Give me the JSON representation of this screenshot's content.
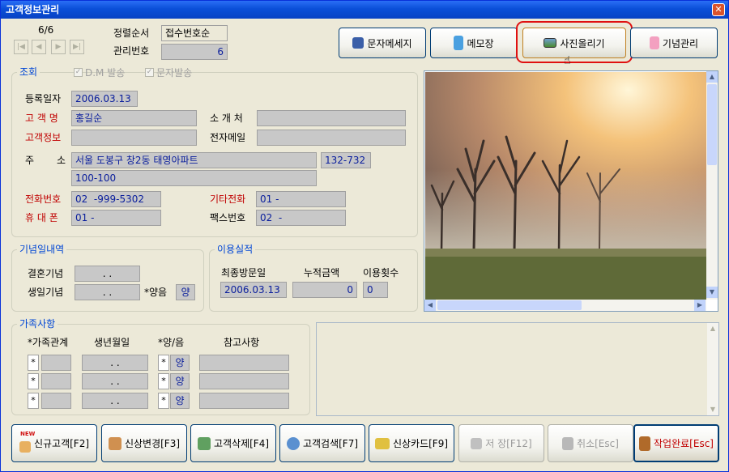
{
  "window": {
    "title": "고객정보관리"
  },
  "record": {
    "counter": "6/6",
    "sort_label": "정렬순서",
    "sort_value": "접수번호순",
    "mgmt_label": "관리번호",
    "mgmt_value": "6"
  },
  "toolbar": {
    "sms": "문자메세지",
    "memo": "메모장",
    "photo": "사진올리기",
    "anniv": "기념관리"
  },
  "inquiry": {
    "title": "조회",
    "dm": "D.M 발송",
    "sms": "문자발송",
    "reg_date_label": "등록일자",
    "reg_date": "2006.03.13",
    "name_label": "고 객 명",
    "name": "홍길순",
    "referrer_label": "소 개 처",
    "referrer": "",
    "info_label": "고객정보",
    "info": "",
    "email_label": "전자메일",
    "email": "",
    "addr_label1": "주",
    "addr_label2": "소",
    "addr1": "서울 도봉구 창2동 태영아파트",
    "zip": "132-732",
    "addr2": "100-100",
    "phone_label": "전화번호",
    "phone": "02  -999-5302",
    "other_phone_label": "기타전화",
    "other_phone": "01 -",
    "mobile_label": "휴 대 폰",
    "mobile": "01 -",
    "fax_label": "팩스번호",
    "fax": "02  -"
  },
  "anniversary": {
    "title": "기념일내역",
    "wedding_label": "결혼기념",
    "wedding": ". .",
    "birth_label": "생일기념",
    "birth": ". .",
    "lunar_label": "*양음",
    "lunar": "양"
  },
  "usage": {
    "title": "이용실적",
    "last_visit_label": "최종방문일",
    "total_label": "누적금액",
    "count_label": "이용횟수",
    "last_visit": "2006.03.13",
    "total": "0",
    "count": "0"
  },
  "family": {
    "title": "가족사항",
    "h_rel": "*가족관계",
    "h_birth": "생년월일",
    "h_lunar": "*양/음",
    "h_note": "참고사항",
    "rows": [
      {
        "star": "*",
        "rel": "",
        "birth": ". .",
        "star2": "*",
        "lunar": "양",
        "note": ""
      },
      {
        "star": "*",
        "rel": "",
        "birth": ". .",
        "star2": "*",
        "lunar": "양",
        "note": ""
      },
      {
        "star": "*",
        "rel": "",
        "birth": ". .",
        "star2": "*",
        "lunar": "양",
        "note": ""
      }
    ]
  },
  "bottom": {
    "new": "신규고객[F2]",
    "edit": "신상변경[F3]",
    "del": "고객삭제[F4]",
    "search": "고객검색[F7]",
    "card": "신상카드[F9]",
    "save": "저 장[F12]",
    "cancel": "취소[Esc]",
    "done": "작업완료[Esc]"
  },
  "new_badge": "NEW",
  "colors": {
    "title_bar": "#0a4fd8",
    "highlight": "#e01010",
    "field_text": "#0a1e9c",
    "label_red": "#c00000"
  }
}
